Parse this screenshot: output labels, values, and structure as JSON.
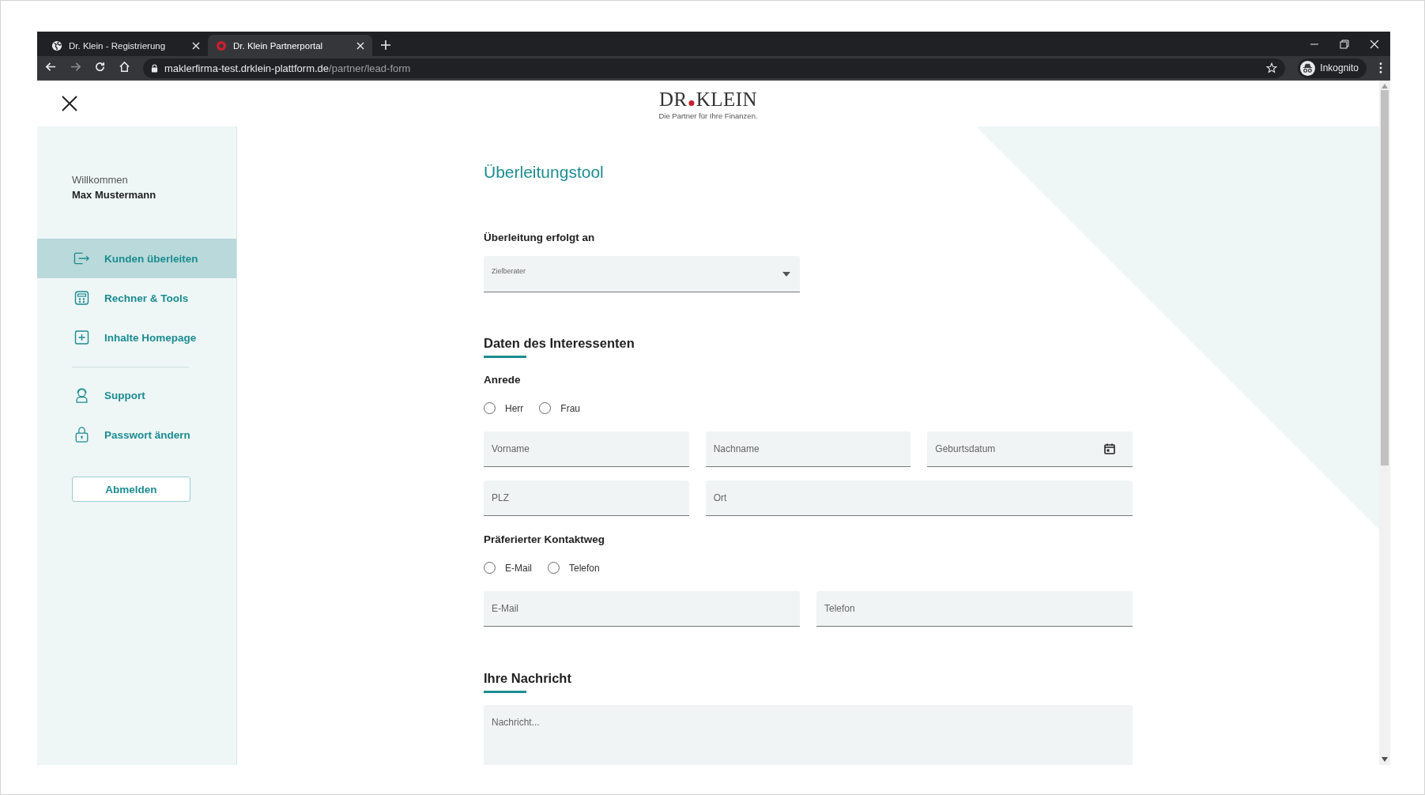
{
  "browser": {
    "tabs": [
      {
        "title": "Dr. Klein - Registrierung",
        "selected": false,
        "kind": "globe"
      },
      {
        "title": "Dr. Klein Partnerportal",
        "selected": true,
        "kind": "brand"
      }
    ],
    "url_host": "maklerfirma-test.drklein-plattform.de",
    "url_path": "/partner/lead-form",
    "profile": "Inkognito"
  },
  "header": {
    "logo_left": "DR",
    "logo_right": "KLEIN",
    "tagline": "Die Partner für Ihre Finanzen."
  },
  "sidebar": {
    "greeting": "Willkommen",
    "user": "Max Mustermann",
    "groups": [
      [
        {
          "label": "Kunden überleiten",
          "kind": "transfer",
          "selected": true
        },
        {
          "label": "Rechner & Tools",
          "kind": "calculator",
          "selected": false
        },
        {
          "label": "Inhalte Homepage",
          "kind": "plus",
          "selected": false
        }
      ],
      [
        {
          "label": "Support",
          "kind": "headset",
          "selected": false
        },
        {
          "label": "Passwort ändern",
          "kind": "lock",
          "selected": false
        }
      ]
    ],
    "logout": "Abmelden"
  },
  "form": {
    "title": "Überleitungstool",
    "transfer": {
      "heading": "Überleitung erfolgt an",
      "select_label": "Zielberater"
    },
    "lead": {
      "heading": "Daten des Interessenten",
      "salutation": {
        "label": "Anrede",
        "options": [
          {
            "label": "Herr",
            "selected": false
          },
          {
            "label": "Frau",
            "selected": false
          }
        ]
      },
      "fields": [
        {
          "placeholder": "Vorname",
          "kind": "text"
        },
        {
          "placeholder": "Nachname",
          "kind": "text"
        },
        {
          "placeholder": "Geburtsdatum",
          "kind": "date"
        },
        {
          "placeholder": "PLZ",
          "kind": "text"
        },
        {
          "placeholder": "Ort",
          "kind": "wide"
        }
      ],
      "contact": {
        "label": "Präferierter Kontaktweg",
        "options": [
          {
            "label": "E-Mail",
            "selected": false
          },
          {
            "label": "Telefon",
            "selected": false
          }
        ]
      },
      "contact_fields": [
        {
          "placeholder": "E-Mail"
        },
        {
          "placeholder": "Telefon"
        }
      ]
    },
    "message": {
      "heading": "Ihre Nachricht",
      "placeholder": "Nachricht..."
    }
  }
}
